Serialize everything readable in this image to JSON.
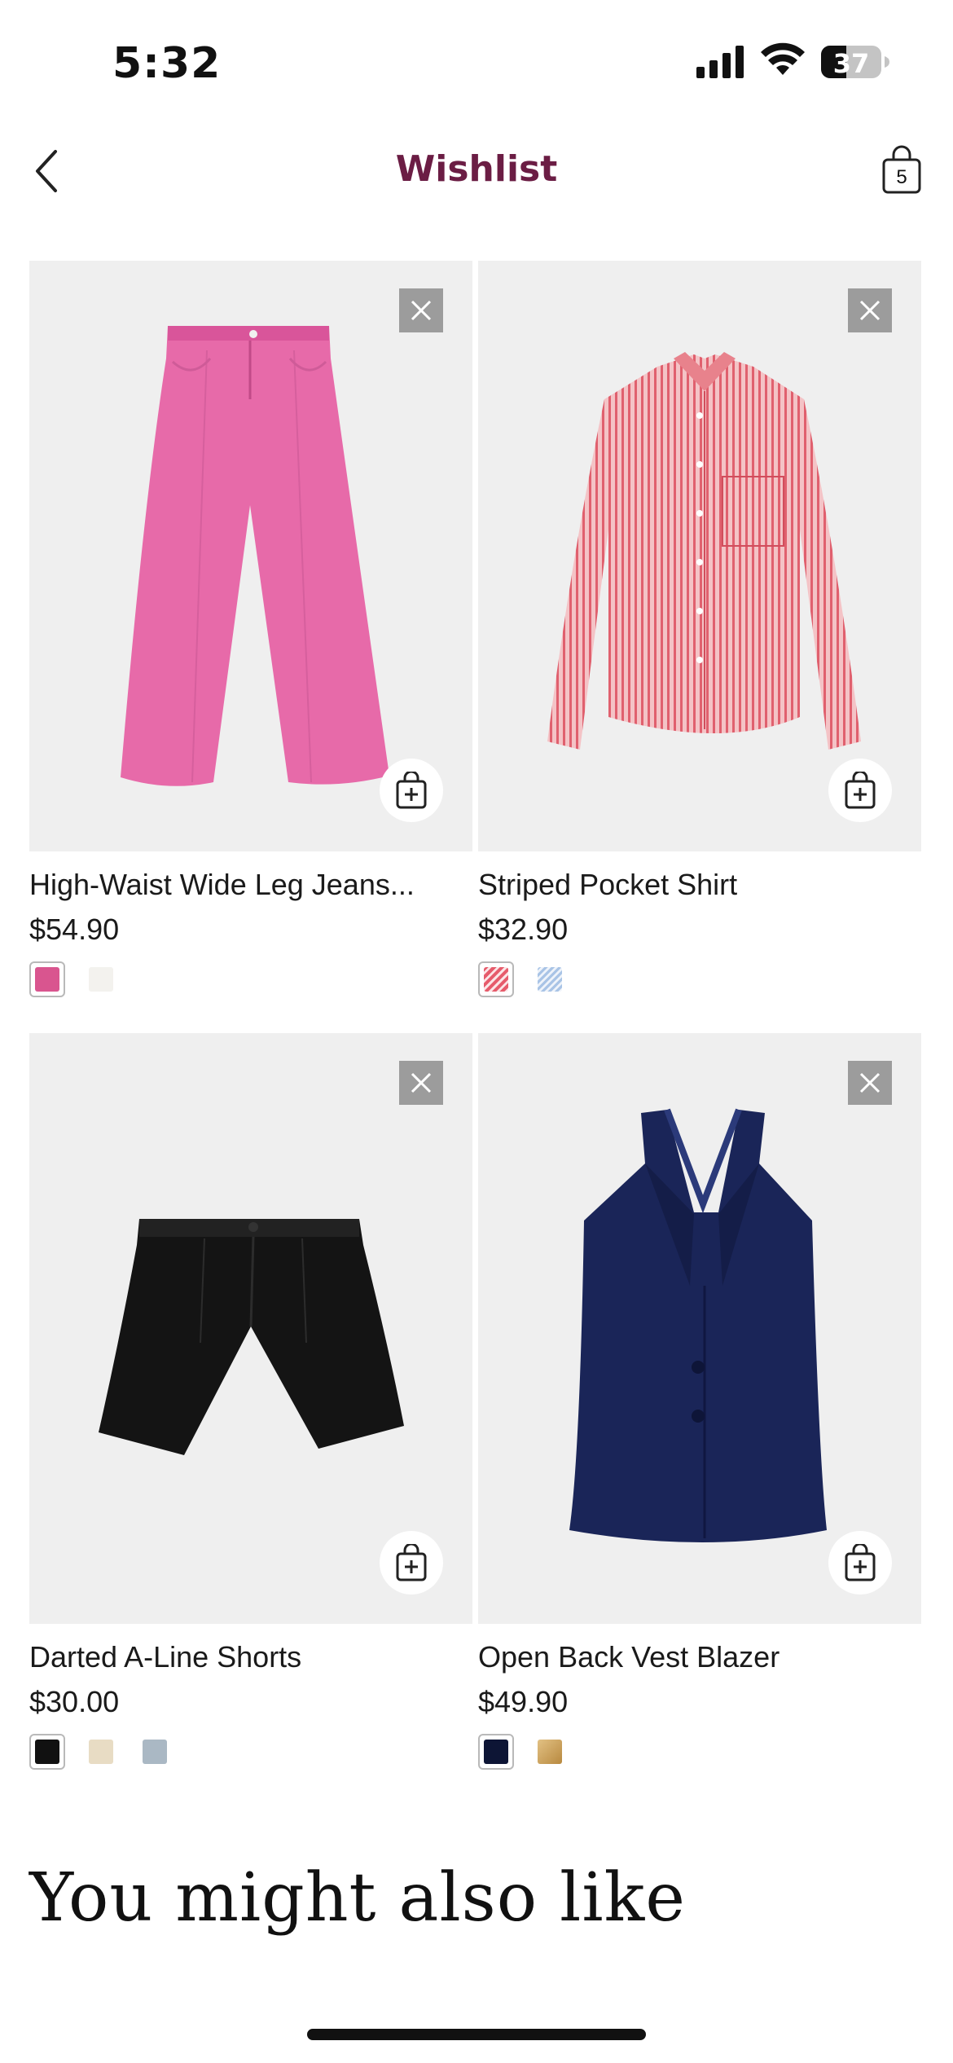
{
  "status": {
    "time": "5:32",
    "battery": "37"
  },
  "nav": {
    "title": "Wishlist",
    "bag_count": "5"
  },
  "products": [
    {
      "name": "High-Waist Wide Leg Jeans...",
      "price": "$54.90",
      "image": "pink-wide-leg-jeans",
      "swatches": [
        "#d9558f",
        "#f3f2ee"
      ],
      "selected_swatch": 0
    },
    {
      "name": "Striped Pocket Shirt",
      "price": "$32.90",
      "image": "red-striped-shirt",
      "swatches": [
        "#e65b6b",
        "#a9c4e6"
      ],
      "selected_swatch": 0
    },
    {
      "name": "Darted A-Line Shorts",
      "price": "$30.00",
      "image": "black-pleated-shorts",
      "swatches": [
        "#111111",
        "#e8dcc4",
        "#aab8c4"
      ],
      "selected_swatch": 0
    },
    {
      "name": "Open Back Vest Blazer",
      "price": "$49.90",
      "image": "navy-halter-vest",
      "swatches": [
        "#0d1535",
        "#c9a15f"
      ],
      "selected_swatch": 0
    }
  ],
  "section": {
    "title": "You might also like"
  },
  "colors": {
    "accent": "#6b1d44",
    "card_bg": "#efefef",
    "remove_bg": "#9c9c9c"
  }
}
